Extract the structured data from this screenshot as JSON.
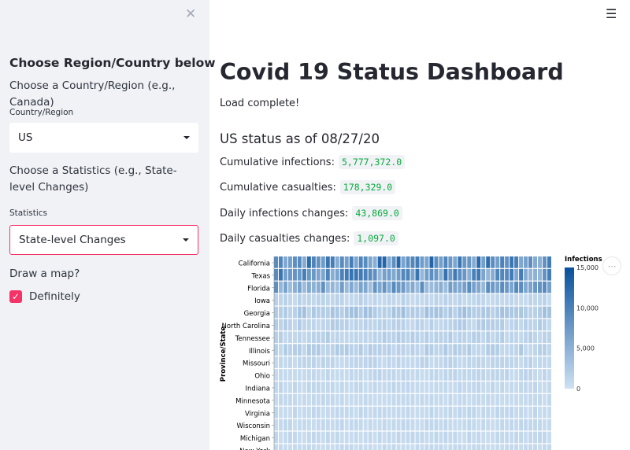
{
  "sidebar": {
    "close_icon": "close-icon",
    "title": "Choose Region/Country below",
    "country_prompt": "Choose a Country/Region (e.g., Canada)",
    "country_label": "Country/Region",
    "country_value": "US",
    "stats_prompt": "Choose a Statistics (e.g., State-level Changes)",
    "stats_label": "Statistics",
    "stats_value": "State-level Changes",
    "map_prompt": "Draw a map?",
    "map_checkbox_label": "Definitely",
    "map_checked": true,
    "accent_color": "#f63366"
  },
  "header": {
    "menu_icon": "hamburger-menu-icon"
  },
  "main": {
    "title": "Covid 19 Status Dashboard",
    "load_status": "Load complete!",
    "status_header": "US status as of 08/27/20",
    "stats": [
      {
        "label": "Cumulative infections:",
        "value": "5,777,372.0"
      },
      {
        "label": "Cumulative casualties:",
        "value": "178,329.0"
      },
      {
        "label": "Daily infections changes:",
        "value": "43,869.0"
      },
      {
        "label": "Daily casualties changes:",
        "value": "1,097.0"
      }
    ]
  },
  "chart_data": {
    "type": "heatmap",
    "ylabel": "Province/State",
    "categories": [
      "California",
      "Texas",
      "Florida",
      "Iowa",
      "Georgia",
      "North Carolina",
      "Tennessee",
      "Illinois",
      "Missouri",
      "Ohio",
      "Indiana",
      "Minnesota",
      "Virginia",
      "Wisconsin",
      "Michigan",
      "New York"
    ],
    "legend_title": "Infections",
    "legend_ticks": [
      "15,000",
      "10,000",
      "5,000",
      "0"
    ],
    "color_range": [
      0,
      15000
    ],
    "color_low": "#cfe1f2",
    "color_high": "#08519c",
    "columns": 59,
    "row_levels": [
      9000,
      8000,
      6500,
      1200,
      2500,
      1600,
      1600,
      1700,
      1100,
      1000,
      900,
      700,
      900,
      800,
      800,
      700
    ]
  }
}
